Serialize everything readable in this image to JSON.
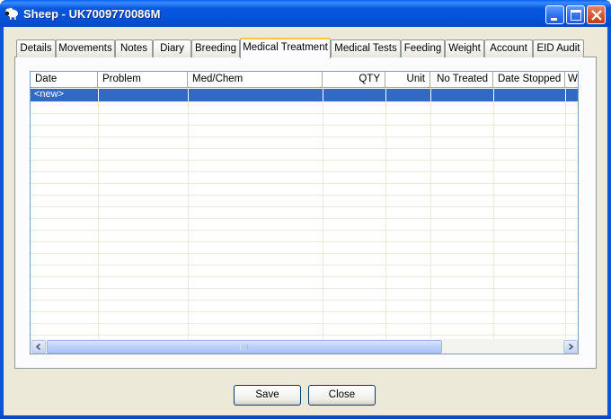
{
  "window": {
    "title": "Sheep - UK7009770086M",
    "controls": {
      "minimize": "minimize-icon",
      "maximize": "maximize-icon",
      "close": "close-icon"
    }
  },
  "tabs": [
    {
      "label": "Details",
      "active": false
    },
    {
      "label": "Movements",
      "active": false
    },
    {
      "label": "Notes",
      "active": false
    },
    {
      "label": "Diary",
      "active": false
    },
    {
      "label": "Breeding",
      "active": false
    },
    {
      "label": "Medical Treatment",
      "active": true
    },
    {
      "label": "Medical Tests",
      "active": false
    },
    {
      "label": "Feeding",
      "active": false
    },
    {
      "label": "Weight",
      "active": false
    },
    {
      "label": "Account",
      "active": false
    },
    {
      "label": "EID Audit",
      "active": false
    }
  ],
  "grid": {
    "columns": [
      "Date",
      "Problem",
      "Med/Chem",
      "QTY",
      "Unit",
      "No Treated",
      "Date Stopped",
      "W"
    ],
    "new_row_label": "<new>"
  },
  "buttons": {
    "save": "Save",
    "close": "Close"
  },
  "colors": {
    "selection": "#316ac5",
    "titlebar": "#0452d8",
    "face": "#ece9d8"
  }
}
